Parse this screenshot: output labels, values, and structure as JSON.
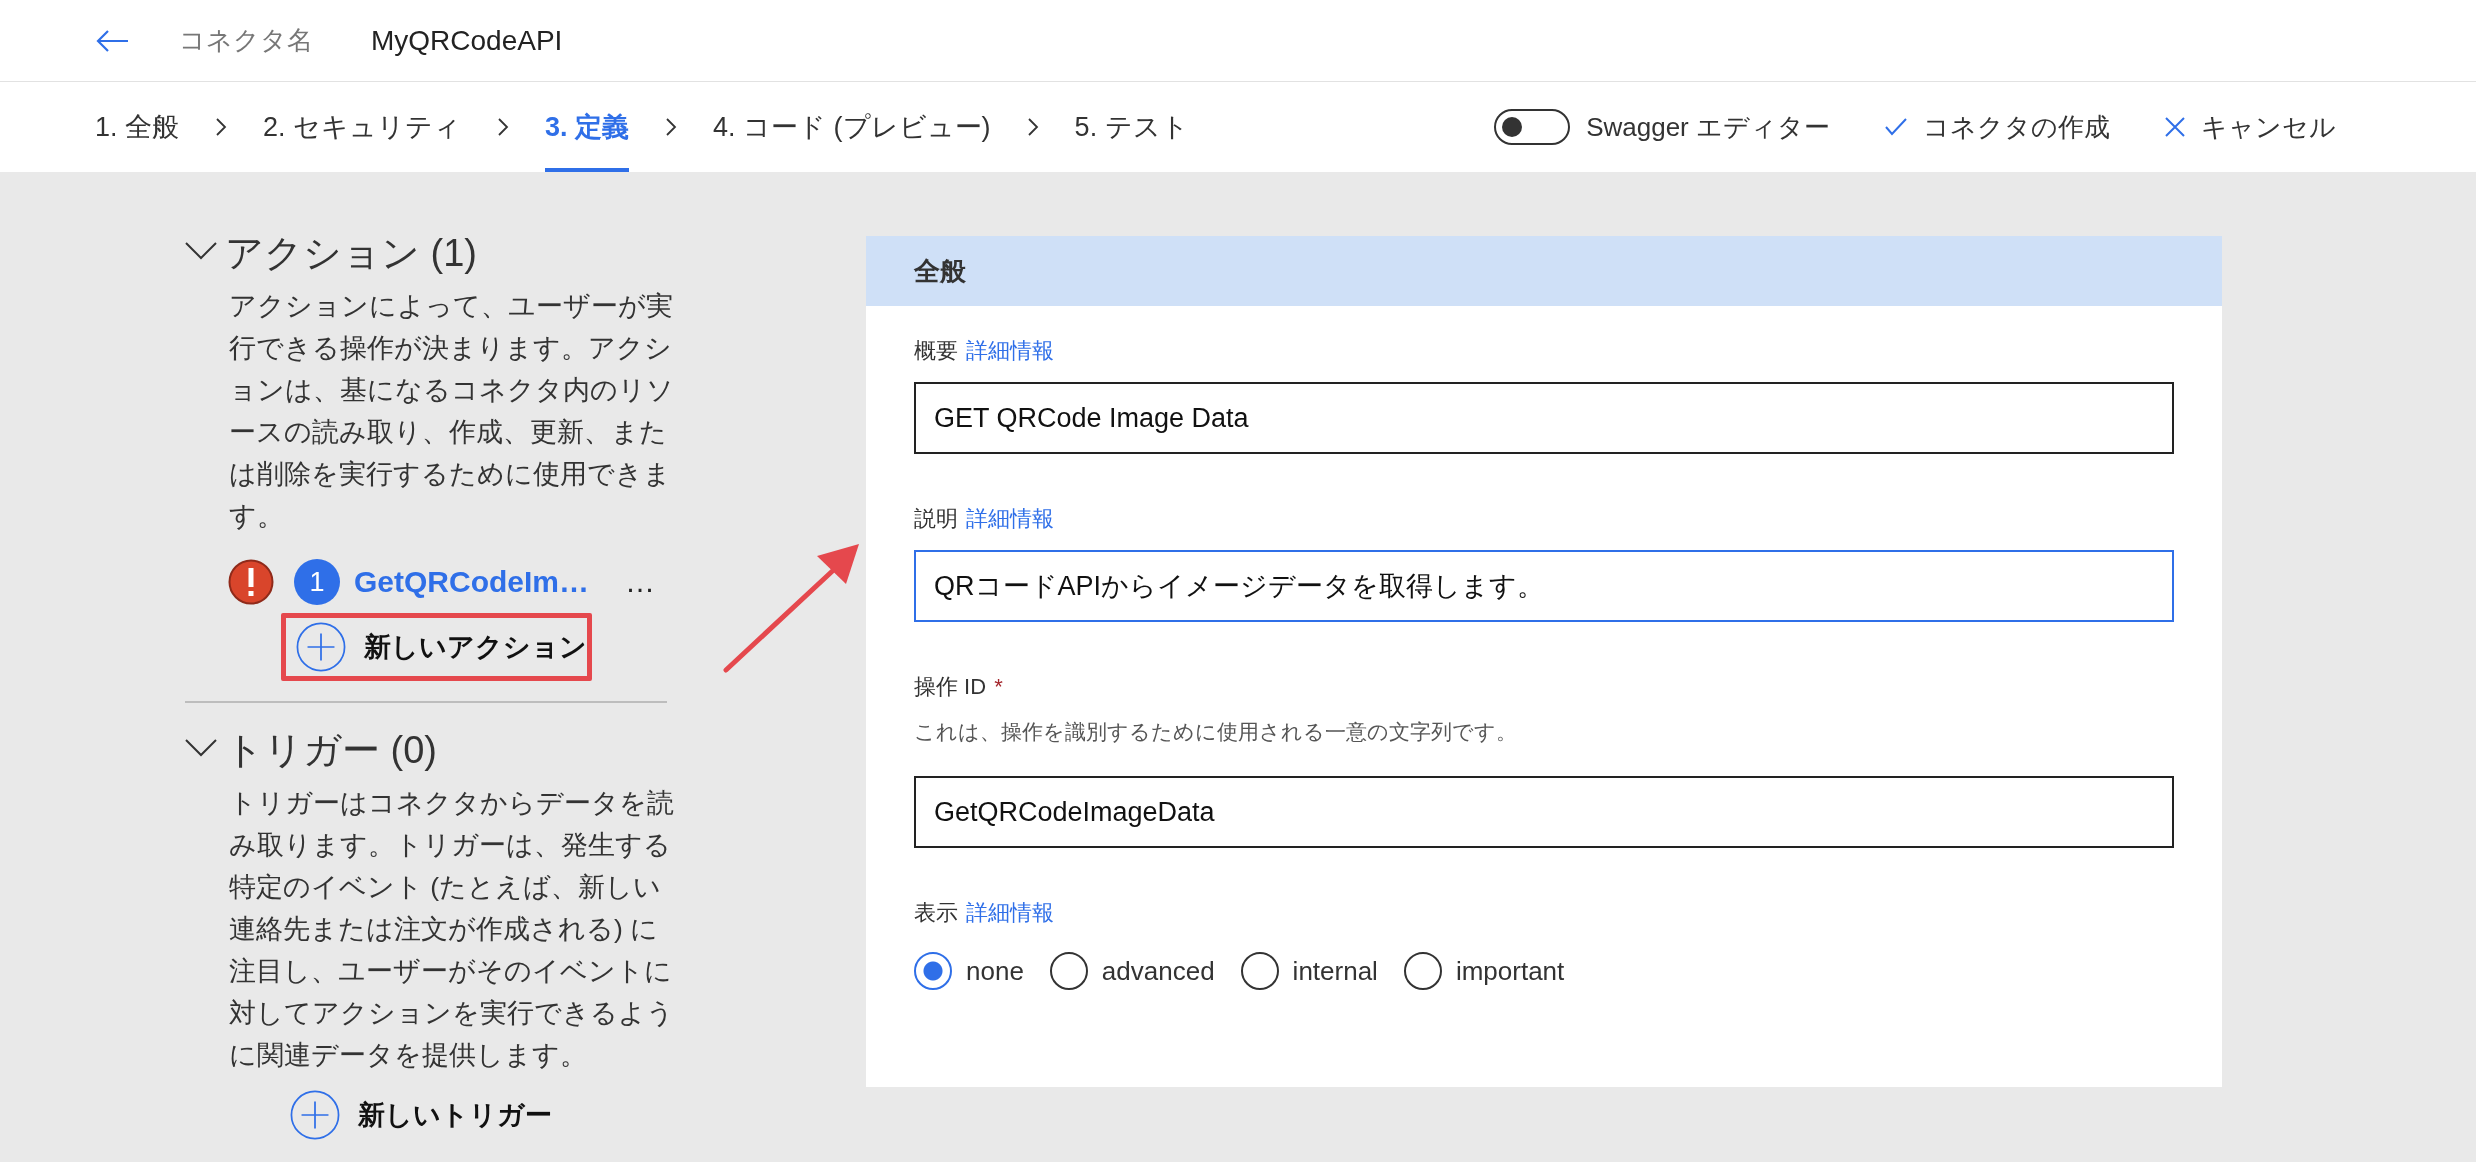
{
  "header": {
    "label": "コネクタ名",
    "connector_name": "MyQRCodeAPI"
  },
  "steps": [
    {
      "label": "1. 全般",
      "selected": false
    },
    {
      "label": "2. セキュリティ",
      "selected": false
    },
    {
      "label": "3. 定義",
      "selected": true
    },
    {
      "label": "4. コード (プレビュー)",
      "selected": false
    },
    {
      "label": "5. テスト",
      "selected": false
    }
  ],
  "toolbar": {
    "swagger_toggle": {
      "label": "Swagger エディター",
      "on": false
    },
    "create": "コネクタの作成",
    "cancel": "キャンセル"
  },
  "actions": {
    "title": "アクション (1)",
    "expanded": true,
    "description": "アクションによって、ユーザーが実行できる操作が決まります。アクションは、基になるコネクタ内のリソースの読み取り、作成、更新、または削除を実行するために使用できます。",
    "items": [
      {
        "number": "1",
        "name": "GetQRCodeIm…",
        "more": "…",
        "error": true
      }
    ],
    "new_button": "新しいアクション"
  },
  "triggers": {
    "title": "トリガー (0)",
    "expanded": true,
    "description": "トリガーはコネクタからデータを読み取ります。トリガーは、発生する特定のイベント (たとえば、新しい連絡先または注文が作成される) に注目し、ユーザーがそのイベントに対してアクションを実行できるように関連データを提供します。",
    "new_button": "新しいトリガー"
  },
  "general_panel": {
    "title": "全般",
    "fields": [
      {
        "label": "概要",
        "link": "詳細情報",
        "value": "GET QRCode Image Data",
        "focused": false
      },
      {
        "label": "説明",
        "link": "詳細情報",
        "value": "QRコードAPIからイメージデータを取得します。",
        "focused": true
      },
      {
        "label": "操作 ID",
        "required": true,
        "required_mark": "*",
        "hint": "これは、操作を識別するために使用される一意の文字列です。",
        "value": "GetQRCodeImageData",
        "focused": false
      }
    ],
    "visibility": {
      "label": "表示",
      "link": "詳細情報",
      "options": [
        {
          "label": "none",
          "selected": true
        },
        {
          "label": "advanced",
          "selected": false
        },
        {
          "label": "internal",
          "selected": false
        },
        {
          "label": "important",
          "selected": false
        }
      ]
    }
  }
}
